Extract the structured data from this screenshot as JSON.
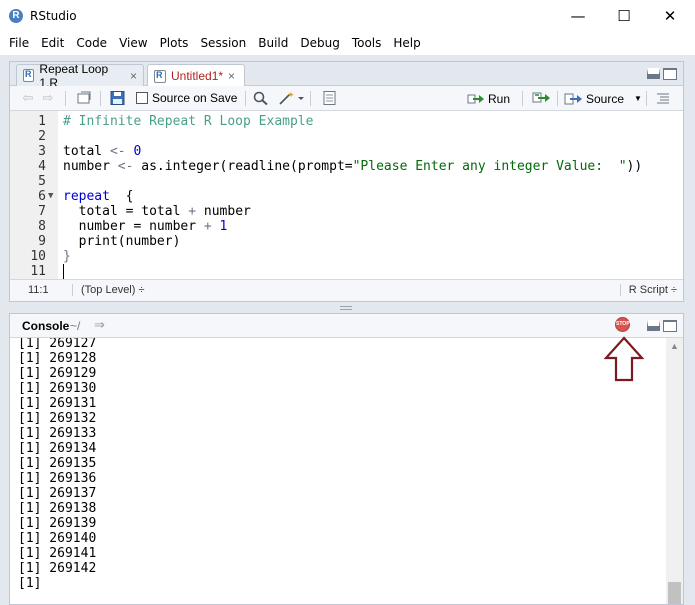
{
  "window": {
    "title": "RStudio",
    "logo_letter": "R",
    "controls": {
      "minimize": "—",
      "maximize": "☐",
      "close": "✕"
    }
  },
  "menu": [
    "File",
    "Edit",
    "Code",
    "View",
    "Plots",
    "Session",
    "Build",
    "Debug",
    "Tools",
    "Help"
  ],
  "editor": {
    "tabs": [
      {
        "label": "Repeat Loop 1.R",
        "close": "×",
        "active": false
      },
      {
        "label": "Untitled1*",
        "close": "×",
        "active": true
      }
    ],
    "toolbar": {
      "source_on_save_label": "Source on Save",
      "source_on_save_checked": false,
      "run_label": "Run",
      "source_label": "Source"
    },
    "line_numbers": [
      "1",
      "2",
      "3",
      "4",
      "5",
      "6",
      "7",
      "8",
      "9",
      "10",
      "11"
    ],
    "code": {
      "l1": "# Infinite Repeat R Loop Example",
      "l3_a": "total ",
      "l3_op": "<-",
      "l3_num": " 0",
      "l4_a": "number ",
      "l4_op": "<-",
      "l4_b": " as.integer(readline(prompt=",
      "l4_str": "\"Please Enter any integer Value:  \"",
      "l4_c": "))",
      "l6_kw": "repeat",
      "l6_b": "  {",
      "l7": "  total = total ",
      "l7_op": "+",
      "l7_b": " number",
      "l8": "  number = number ",
      "l8_op": "+",
      "l8_num": " 1",
      "l9": "  print(number)",
      "l10": "}"
    },
    "status": {
      "position": "11:1",
      "scope": "(Top Level) ÷",
      "file_type": "R Script ÷"
    }
  },
  "console": {
    "title": "Console",
    "path": "~/",
    "output": [
      "[1] 269127",
      "[1] 269128",
      "[1] 269129",
      "[1] 269130",
      "[1] 269131",
      "[1] 269132",
      "[1] 269133",
      "[1] 269134",
      "[1] 269135",
      "[1] 269136",
      "[1] 269137",
      "[1] 269138",
      "[1] 269139",
      "[1] 269140",
      "[1] 269141",
      "[1] 269142",
      "[1]"
    ],
    "stop_icon_text": "STOP"
  },
  "colors": {
    "accent_arrow": "#7b1a1f",
    "comment": "#4a9f8a",
    "number": "#0000cd",
    "string": "#036a07",
    "stop": "#d9534f"
  }
}
